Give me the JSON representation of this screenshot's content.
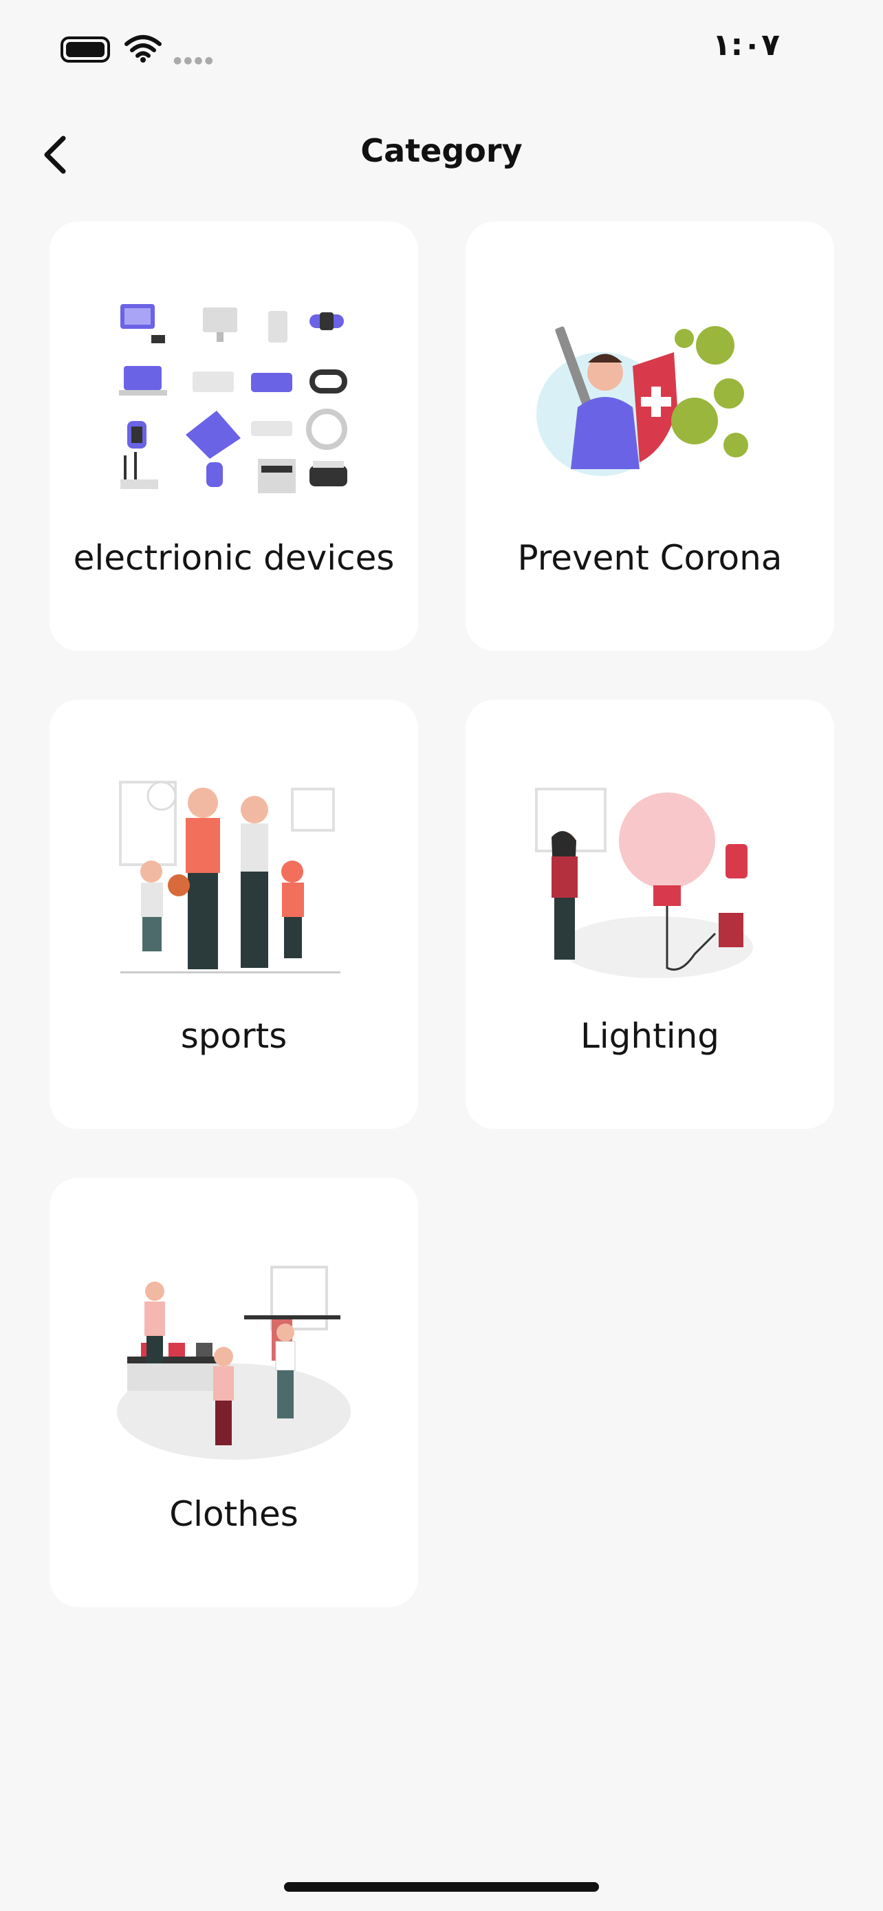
{
  "status_bar": {
    "time": "١:٠٧"
  },
  "nav": {
    "title": "Category"
  },
  "categories": [
    {
      "label": "electrionic devices"
    },
    {
      "label": "Prevent Corona"
    },
    {
      "label": "sports"
    },
    {
      "label": "Lighting"
    },
    {
      "label": "Clothes"
    }
  ],
  "colors": {
    "background": "#f7f7f7",
    "card": "#ffffff",
    "text": "#141414",
    "accent_purple": "#6b63e6",
    "accent_coral": "#f26f5b",
    "accent_red": "#d93a4b",
    "accent_green": "#9ab63c"
  }
}
